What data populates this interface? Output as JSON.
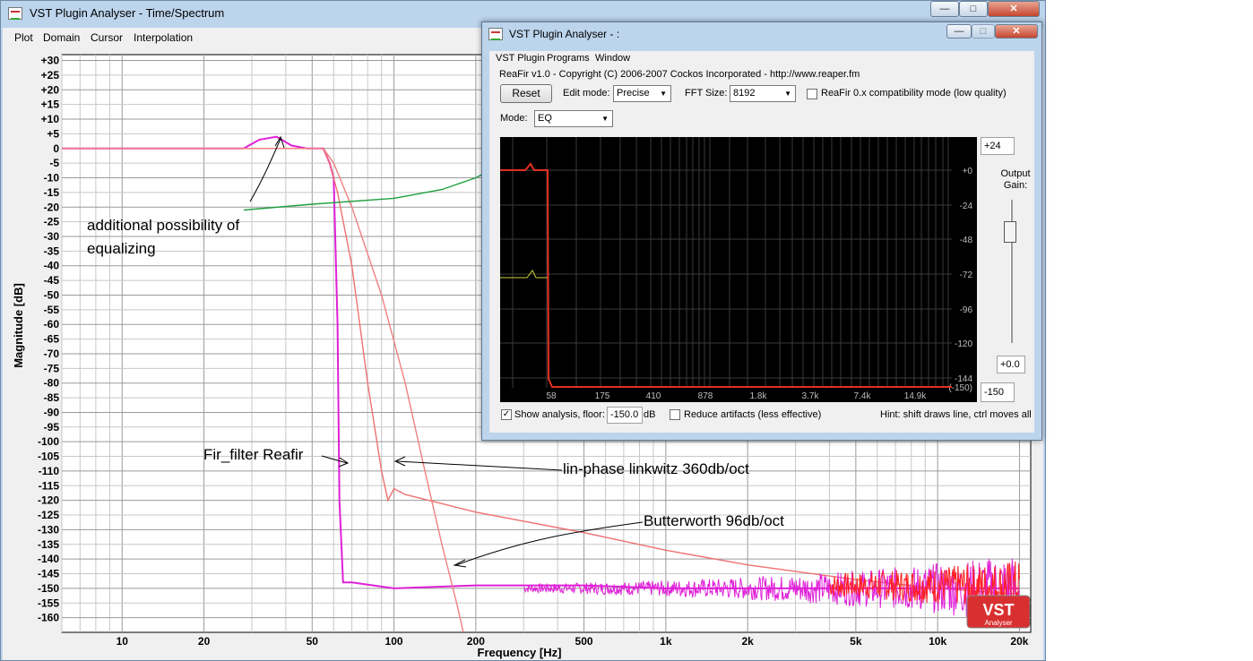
{
  "main_window": {
    "title": "VST Plugin Analyser - Time/Spectrum",
    "menu": [
      "Plot",
      "Domain",
      "Cursor",
      "Interpolation"
    ],
    "controls": {
      "minimize": "—",
      "maximize": "□",
      "close": "✕"
    }
  },
  "plot": {
    "ylabel": "Magnitude [dB]",
    "xlabel": "Frequency [Hz]",
    "y_ticks": [
      "+30",
      "+25",
      "+20",
      "+15",
      "+10",
      "+5",
      "0",
      "-5",
      "-10",
      "-15",
      "-20",
      "-25",
      "-30",
      "-35",
      "-40",
      "-45",
      "-50",
      "-55",
      "-60",
      "-65",
      "-70",
      "-75",
      "-80",
      "-85",
      "-90",
      "-95",
      "-100",
      "-105",
      "-110",
      "-115",
      "-120",
      "-125",
      "-130",
      "-135",
      "-140",
      "-145",
      "-150",
      "-155",
      "-160"
    ],
    "x_ticks": [
      "10",
      "20",
      "50",
      "100",
      "200",
      "500",
      "1k",
      "2k",
      "5k",
      "10k",
      "20k"
    ],
    "logo_text": "VST",
    "logo_sub": "Analyser"
  },
  "chart_data": {
    "type": "line",
    "xlabel": "Frequency [Hz]",
    "ylabel": "Magnitude [dB]",
    "x_scale": "log",
    "xlim": [
      6,
      22000
    ],
    "ylim": [
      -165,
      32
    ],
    "grid": true,
    "series": [
      {
        "color": "#e020d8",
        "points": [
          [
            6,
            0
          ],
          [
            28,
            0
          ],
          [
            32,
            3
          ],
          [
            37,
            4
          ],
          [
            42,
            1
          ],
          [
            48,
            0
          ],
          [
            55,
            0
          ],
          [
            58,
            -5
          ],
          [
            60,
            -10
          ],
          [
            62,
            -60
          ],
          [
            63,
            -120
          ],
          [
            65,
            -148
          ],
          [
            70,
            -148
          ],
          [
            100,
            -150
          ],
          [
            200,
            -149
          ],
          [
            500,
            -149
          ],
          [
            1000,
            -150
          ],
          [
            2000,
            -150
          ],
          [
            5000,
            -150
          ],
          [
            10000,
            -150
          ],
          [
            20000,
            -150
          ]
        ]
      },
      {
        "color": "#f07070",
        "points": [
          [
            6,
            0
          ],
          [
            55,
            0
          ],
          [
            58,
            -5
          ],
          [
            62,
            -15
          ],
          [
            70,
            -40
          ],
          [
            80,
            -80
          ],
          [
            90,
            -110
          ],
          [
            95,
            -120
          ],
          [
            100,
            -116
          ],
          [
            110,
            -118
          ],
          [
            200,
            -124
          ],
          [
            500,
            -131
          ],
          [
            1000,
            -137
          ],
          [
            2000,
            -142
          ],
          [
            5000,
            -147
          ],
          [
            10000,
            -150
          ],
          [
            20000,
            -152
          ]
        ]
      },
      {
        "color": "#f08080",
        "points": [
          [
            6,
            0
          ],
          [
            55,
            0
          ],
          [
            60,
            -5
          ],
          [
            70,
            -20
          ],
          [
            90,
            -50
          ],
          [
            110,
            -80
          ],
          [
            130,
            -110
          ],
          [
            150,
            -135
          ],
          [
            170,
            -155
          ],
          [
            180,
            -165
          ]
        ]
      },
      {
        "color": "#20a040",
        "points": [
          [
            28,
            -21
          ],
          [
            50,
            -19
          ],
          [
            100,
            -17
          ],
          [
            150,
            -14
          ],
          [
            200,
            -10
          ],
          [
            230,
            -7
          ]
        ]
      }
    ]
  },
  "annotations": {
    "eq": [
      "additional possibility of",
      "equalizing"
    ],
    "fir": "Fir_filter Reafir",
    "linkwitz": "lin-phase linkwitz 360db/oct",
    "butterworth": "Butterworth 96db/oct"
  },
  "sub_window": {
    "title": "VST Plugin Analyser - :",
    "menu": [
      "VST Plugin",
      "Programs",
      "Window"
    ],
    "plugin_info": "ReaFir v1.0 - Copyright (C) 2006-2007 Cockos Incorporated - http://www.reaper.fm",
    "reset_label": "Reset",
    "edit_mode_label": "Edit mode:",
    "edit_mode_value": "Precise",
    "fft_label": "FFT Size:",
    "fft_value": "8192",
    "compat_label": "ReaFir 0.x compatibility mode (low quality)",
    "mode_label": "Mode:",
    "mode_value": "EQ",
    "graph_y_ticks": [
      "+0",
      "-24",
      "-48",
      "-72",
      "-96",
      "-120",
      "-144",
      "(-150)"
    ],
    "graph_x_ticks": [
      "58",
      "175",
      "410",
      "878",
      "1.8k",
      "3.7k",
      "7.4k",
      "14.9k"
    ],
    "top_value": "+24",
    "output_gain_label": "Output Gain:",
    "gain_value": "+0.0",
    "bottom_value": "-150",
    "show_analysis_label": "Show analysis, floor:",
    "floor_value": "-150.0",
    "floor_unit": "dB",
    "reduce_label": "Reduce artifacts (less effective)",
    "hint": "Hint: shift draws line, ctrl moves all"
  }
}
